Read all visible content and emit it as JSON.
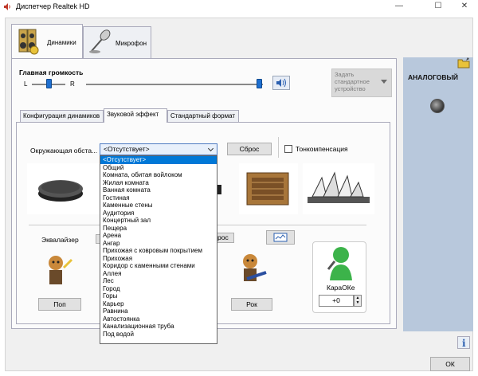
{
  "window": {
    "title": "Диспетчер Realtek HD",
    "minimize": "—",
    "maximize": "☐",
    "close": "✕"
  },
  "device_tabs": [
    {
      "label": "Динамики",
      "icon": "speakers-icon",
      "selected": true
    },
    {
      "label": "Микрофон",
      "icon": "microphone-icon",
      "selected": false
    }
  ],
  "volume": {
    "title": "Главная громкость",
    "left_label": "L",
    "right_label": "R",
    "balance_fraction": 0.5,
    "level_fraction": 1.0
  },
  "default_device": {
    "label": "Задать стандартное устройство",
    "enabled": false
  },
  "right_panel": {
    "label": "АНАЛОГОВЫЙ"
  },
  "sub_tabs": [
    {
      "label": "Конфигурация динамиков",
      "selected": false
    },
    {
      "label": "Звуковой эффект",
      "selected": true
    },
    {
      "label": "Стандартный формат",
      "selected": false
    }
  ],
  "environment": {
    "label": "Окружающая обста...",
    "selected": "<Отсутствует>",
    "reset_label": "Сброс",
    "toncomp_label": "Тонкомпенсация",
    "toncomp_checked": false,
    "options": [
      "<Отсутствует>",
      "Общий",
      "Комната, обитая войлоком",
      "Жилая комната",
      "Ванная комната",
      "Гостиная",
      "Каменные стены",
      "Аудитория",
      "Концертный зал",
      "Пещера",
      "Арена",
      "Ангар",
      "Прихожая с ковровым покрытием",
      "Прихожая",
      "Коридор с каменными стенами",
      "Аллея",
      "Лес",
      "Город",
      "Горы",
      "Карьер",
      "Равнина",
      "Автостоянка",
      "Канализационная труба",
      "Под водой"
    ]
  },
  "equalizer": {
    "label": "Эквалайзер",
    "reset_partial": "рос",
    "pop_label": "Поп",
    "rock_label": "Рок"
  },
  "karaoke": {
    "label": "КараОКе",
    "value": "+0"
  },
  "ok_label": "ОК",
  "colors": {
    "accent": "#0078d7",
    "slider": "#1e6fd0",
    "right_panel": "#b8c8dc"
  }
}
